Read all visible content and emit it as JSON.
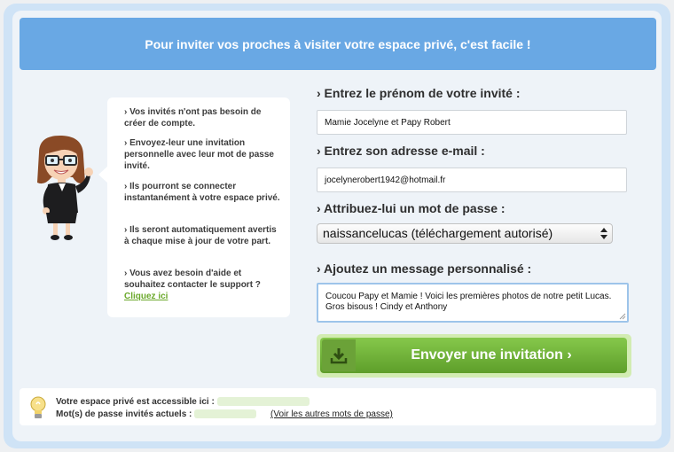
{
  "banner": {
    "text": "Pour inviter vos proches à visiter votre espace privé, c'est facile !"
  },
  "tips": [
    "› Vos invités n'ont pas besoin de créer de compte.",
    "› Envoyez-leur une invitation personnelle avec leur mot de passe invité.",
    "› Ils pourront se connecter instantanément à votre espace privé.",
    "› Ils seront automatiquement avertis à chaque mise à jour de votre part.",
    "› Vous avez besoin d'aide et souhaitez contacter le support ?"
  ],
  "support_link": "Cliquez ici",
  "form": {
    "firstname_label": "› Entrez le prénom de votre invité :",
    "firstname_value": "Mamie Jocelyne et Papy Robert",
    "email_label": "› Entrez son adresse e-mail :",
    "email_value": "jocelynerobert1942@hotmail.fr",
    "password_label": "› Attribuez-lui un mot de passe :",
    "password_value": "naissancelucas (téléchargement autorisé)",
    "message_label": "› Ajoutez un message personnalisé :",
    "message_value": "Coucou Papy et Mamie ! Voici les premières photos de notre petit Lucas. Gros bisous ! Cindy et Anthony",
    "send_label": "Envoyer une invitation ›"
  },
  "footer": {
    "access_label": "Votre espace privé est accessible ici :",
    "passwords_label": "Mot(s) de passe invités actuels :",
    "other_passwords_link": "(Voir les autres mots de passe)"
  },
  "colors": {
    "banner": "#69a8e4",
    "accent_green": "#6aa82a",
    "panel": "#eef3f8"
  },
  "icons": {
    "avatar": "assistant-woman-avatar",
    "send": "download-icon",
    "bulb": "lightbulb-icon",
    "select": "select-arrows-icon"
  }
}
